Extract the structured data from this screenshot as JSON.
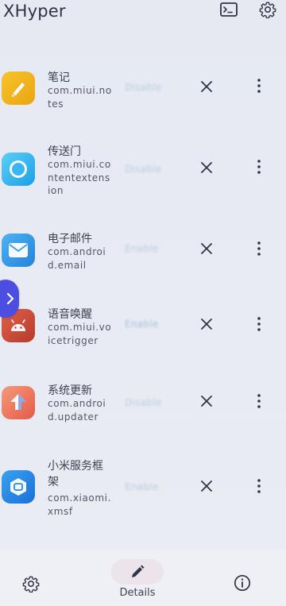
{
  "app": {
    "title": "XHyper"
  },
  "toolbar": {
    "terminal_icon": "terminal-icon",
    "settings_icon": "gear-icon"
  },
  "apps": [
    {
      "name": "笔记",
      "package": "com.miui.notes",
      "state": "Disable",
      "icon": "notes-app-icon",
      "color": "#f2b81e"
    },
    {
      "name": "传送门",
      "package": "com.miui.contentextension",
      "state": "Disable",
      "icon": "content-extension-app-icon",
      "color": "#39b9f0"
    },
    {
      "name": "电子邮件",
      "package": "com.android.email",
      "state": "Enable",
      "icon": "email-app-icon",
      "color": "#3aa0e6"
    },
    {
      "name": "语音唤醒",
      "package": "com.miui.voicetrigger",
      "state": "Enable",
      "icon": "android-app-icon",
      "color": "#d9533e"
    },
    {
      "name": "系统更新",
      "package": "com.android.updater",
      "state": "Disable",
      "icon": "updater-app-icon",
      "color": "#f07a5a"
    },
    {
      "name": "小米服务框架",
      "package": "com.xiaomi.xmsf",
      "state": "Enable",
      "icon": "xmsf-app-icon",
      "color": "#2c8ae8"
    }
  ],
  "bottom_nav": {
    "settings_icon": "gear-icon",
    "details_label": "Details",
    "info_icon": "info-icon"
  }
}
